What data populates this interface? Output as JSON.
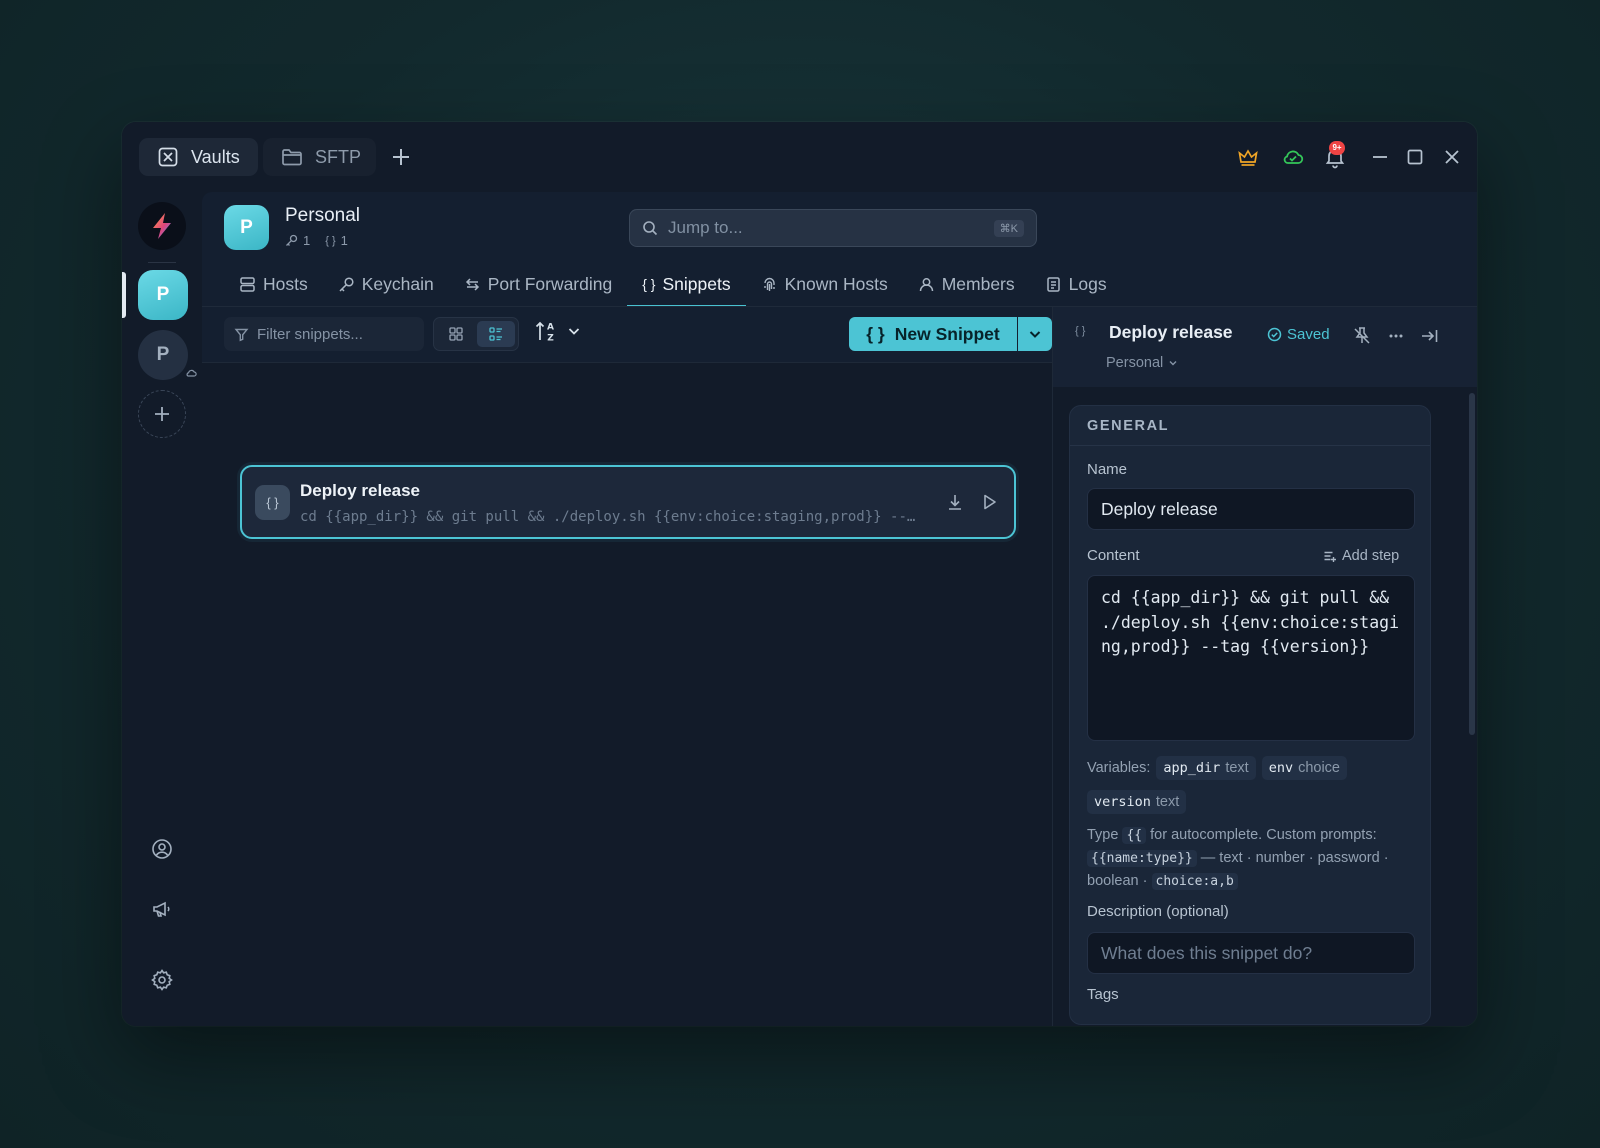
{
  "titlebar": {
    "tabs": [
      {
        "label": "Vaults",
        "icon": "vault-icon"
      },
      {
        "label": "SFTP",
        "icon": "folder-icon"
      }
    ],
    "notification_count": "9+",
    "colors": {
      "crown": "#f0a526",
      "cloud": "#34c759",
      "badge": "#ef4444"
    }
  },
  "rail": {
    "active_vault_letter": "P",
    "other_vault_letter": "P"
  },
  "vault": {
    "avatar_letter": "P",
    "name": "Personal",
    "key_count": "1",
    "snippet_count": "1"
  },
  "search": {
    "placeholder": "Jump to...",
    "shortcut": "⌘K"
  },
  "nav": {
    "hosts": "Hosts",
    "keychain": "Keychain",
    "port_forwarding": "Port Forwarding",
    "snippets": "Snippets",
    "known_hosts": "Known Hosts",
    "members": "Members",
    "logs": "Logs",
    "active": "Snippets"
  },
  "toolbar": {
    "filter_placeholder": "Filter snippets...",
    "view_mode": "list",
    "new_snippet_label": "New Snippet"
  },
  "snippets": [
    {
      "title": "Deploy release",
      "command": "cd {{app_dir}} && git pull && ./deploy.sh {{env:choice:staging,prod}} --tag {{version}}"
    }
  ],
  "panel": {
    "title": "Deploy release",
    "status": "Saved",
    "vault": "Personal",
    "section_title": "GENERAL",
    "name_label": "Name",
    "name_value": "Deploy release",
    "content_label": "Content",
    "add_step_label": "Add step",
    "content_value": "cd {{app_dir}} && git pull && ./deploy.sh {{env:choice:staging,prod}} --tag {{version}}",
    "variables_label": "Variables:",
    "variables": [
      {
        "name": "app_dir",
        "type": "text"
      },
      {
        "name": "env",
        "type": "choice"
      },
      {
        "name": "version",
        "type": "text"
      }
    ],
    "help": {
      "type_word": "Type",
      "autocomplete_trigger": "{{",
      "autocomplete_text": "for autocomplete. Custom prompts:",
      "syntax": "{{name:type}}",
      "types_text": "— text · number · password · boolean ·",
      "choice_syntax": "choice:a,b"
    },
    "description_label": "Description (optional)",
    "description_placeholder": "What does this snippet do?",
    "tags_label": "Tags"
  }
}
